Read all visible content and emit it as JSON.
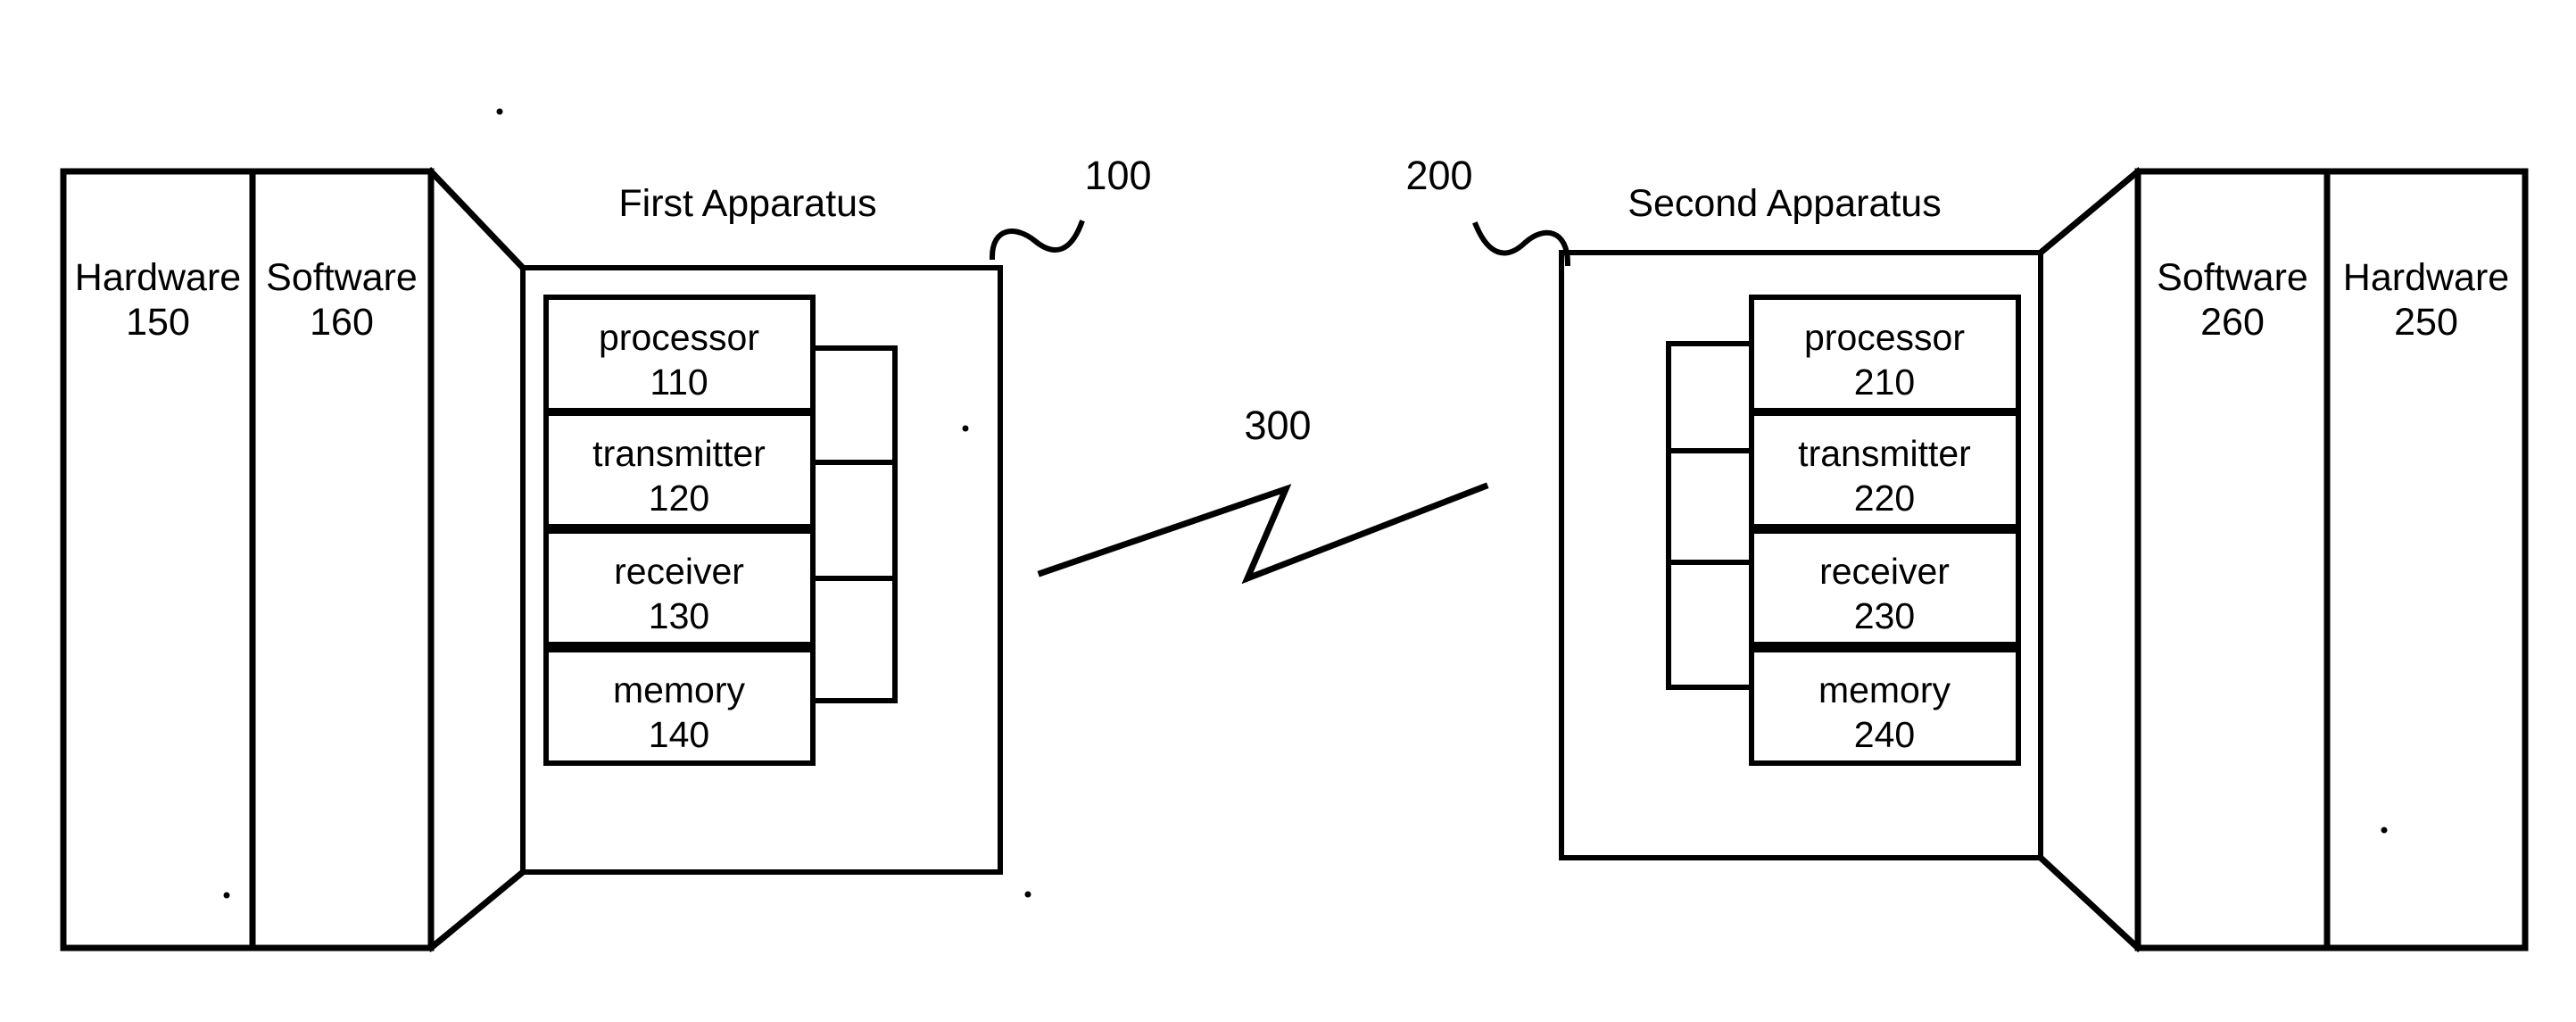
{
  "figure": {
    "background_color": "#ffffff",
    "line_color": "#000000",
    "type": "patent-block-diagram"
  },
  "left_panels": {
    "hardware": {
      "label": "Hardware",
      "ref": "150"
    },
    "software": {
      "label": "Software",
      "ref": "160"
    }
  },
  "right_panels": {
    "software": {
      "label": "Software",
      "ref": "260"
    },
    "hardware": {
      "label": "Hardware",
      "ref": "250"
    }
  },
  "first_apparatus": {
    "title": "First Apparatus",
    "ref": "100",
    "components": [
      {
        "label": "processor",
        "ref": "110"
      },
      {
        "label": "transmitter",
        "ref": "120"
      },
      {
        "label": "receiver",
        "ref": "130"
      },
      {
        "label": "memory",
        "ref": "140"
      }
    ]
  },
  "second_apparatus": {
    "title": "Second Apparatus",
    "ref": "200",
    "components": [
      {
        "label": "processor",
        "ref": "210"
      },
      {
        "label": "transmitter",
        "ref": "220"
      },
      {
        "label": "receiver",
        "ref": "230"
      },
      {
        "label": "memory",
        "ref": "240"
      }
    ]
  },
  "wireless_link": {
    "ref": "300",
    "symbol": "lightning-bolt-icon"
  }
}
